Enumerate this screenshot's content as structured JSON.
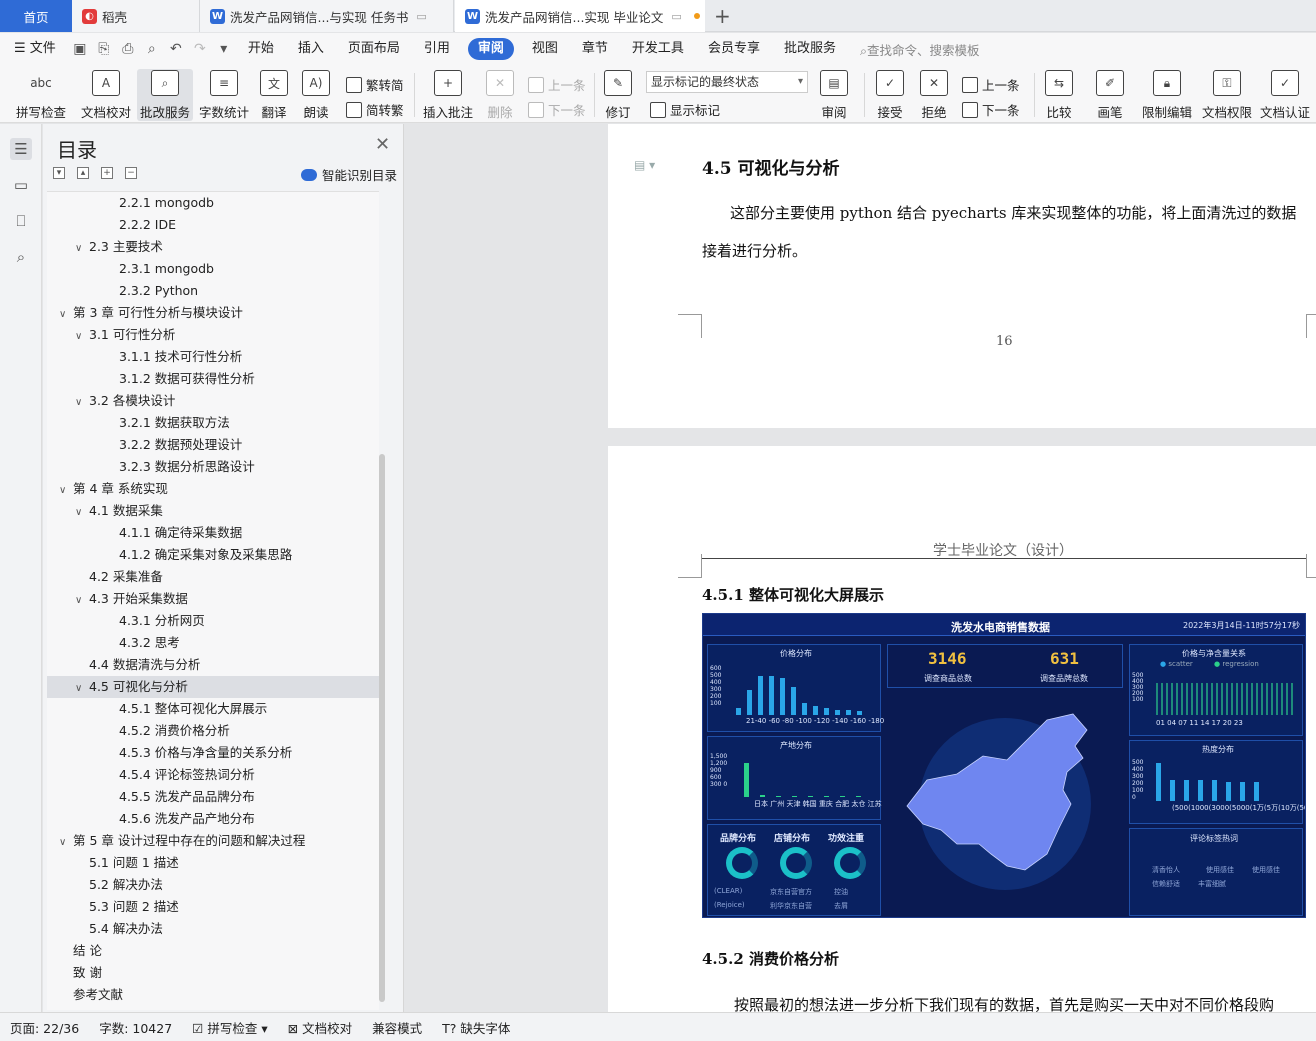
{
  "tabs": {
    "home": "首页",
    "t1": "稻壳",
    "t2": "洗发产品网销信...与实现 任务书",
    "t3": "洗发产品网销信...实现 毕业论文"
  },
  "menu": {
    "file": "文件",
    "items": [
      "开始",
      "插入",
      "页面布局",
      "引用",
      "审阅",
      "视图",
      "章节",
      "开发工具",
      "会员专享",
      "批改服务"
    ],
    "search": "查找命令、搜索模板"
  },
  "ribbon": {
    "spell": "拼写检查",
    "proof": "文档校对",
    "correct": "批改服务",
    "wordcount": "字数统计",
    "translate": "翻译",
    "read": "朗读",
    "to_trad": "繁转简",
    "to_simp": "简转繁",
    "insert_comment": "插入批注",
    "delete": "删除",
    "prev": "上一条",
    "next": "下一条",
    "revise": "修订",
    "markup_state": "显示标记的最终状态",
    "show_markup": "显示标记",
    "review": "审阅",
    "accept": "接受",
    "reject": "拒绝",
    "prev2": "上一条",
    "next2": "下一条",
    "compare": "比较",
    "pen": "画笔",
    "restrict": "限制编辑",
    "perm": "文档权限",
    "cert": "文档认证"
  },
  "toc": {
    "title": "目录",
    "smart": "智能识别目录",
    "items": [
      {
        "text": "2.2.1 mongodb",
        "level": 3
      },
      {
        "text": "2.2.2 IDE",
        "level": 3
      },
      {
        "text": "2.3 主要技术",
        "level": 2,
        "chev": true
      },
      {
        "text": "2.3.1 mongodb",
        "level": 3
      },
      {
        "text": "2.3.2 Python",
        "level": 3
      },
      {
        "text": "第 3 章  可行性分析与模块设计",
        "level": 1,
        "chev": true
      },
      {
        "text": "3.1  可行性分析",
        "level": 2,
        "chev": true
      },
      {
        "text": "3.1.1  技术可行性分析",
        "level": 3
      },
      {
        "text": "3.1.2  数据可获得性分析",
        "level": 3
      },
      {
        "text": "3.2  各模块设计",
        "level": 2,
        "chev": true
      },
      {
        "text": "3.2.1  数据获取方法",
        "level": 3
      },
      {
        "text": "3.2.2  数据预处理设计",
        "level": 3
      },
      {
        "text": "3.2.3  数据分析思路设计",
        "level": 3
      },
      {
        "text": "第 4 章  系统实现",
        "level": 1,
        "chev": true
      },
      {
        "text": "4.1 数据采集",
        "level": 2,
        "chev": true
      },
      {
        "text": "4.1.1 确定待采集数据",
        "level": 3
      },
      {
        "text": "4.1.2 确定采集对象及采集思路",
        "level": 3
      },
      {
        "text": "4.2 采集准备",
        "level": 2
      },
      {
        "text": "4.3 开始采集数据",
        "level": 2,
        "chev": true
      },
      {
        "text": "4.3.1 分析网页",
        "level": 3
      },
      {
        "text": "4.3.2 思考",
        "level": 3
      },
      {
        "text": "4.4 数据清洗与分析",
        "level": 2
      },
      {
        "text": "4.5  可视化与分析",
        "level": 2,
        "chev": true,
        "highlight": true
      },
      {
        "text": "4.5.1  整体可视化大屏展示",
        "level": 3
      },
      {
        "text": "4.5.2 消费价格分析",
        "level": 3
      },
      {
        "text": "4.5.3 价格与净含量的关系分析",
        "level": 3
      },
      {
        "text": "4.5.4  评论标签热词分析",
        "level": 3
      },
      {
        "text": "4.5.5  洗发产品品牌分布",
        "level": 3
      },
      {
        "text": "4.5.6  洗发产品产地分布",
        "level": 3
      },
      {
        "text": "第 5 章  设计过程中存在的问题和解决过程",
        "level": 1,
        "chev": true
      },
      {
        "text": "5.1 问题 1 描述",
        "level": 2
      },
      {
        "text": "5.2 解决办法",
        "level": 2
      },
      {
        "text": "5.3 问题 2 描述",
        "level": 2
      },
      {
        "text": "5.4 解决办法",
        "level": 2
      },
      {
        "text": "结    论",
        "level": 1
      },
      {
        "text": "致    谢",
        "level": 1
      },
      {
        "text": "参考文献",
        "level": 1
      }
    ]
  },
  "doc": {
    "h45": "4.5  可视化与分析",
    "p1a": "这部分主要使用 python 结合 pyecharts 库来实现整体的功能，将上面清洗过的数据",
    "p1b": "接着进行分析。",
    "pagenum": "16",
    "header": "学士毕业论文（设计）",
    "h451": "4.5.1  整体可视化大屏展示",
    "h452": "4.5.2 消费价格分析",
    "p2": "按照最初的想法进一步分析下我们现有的数据，首先是购买一天中对不同价格段购"
  },
  "dashboard": {
    "title": "洗发水电商销售数据",
    "time": "2022年3月14日-11时57分17秒",
    "price_dist": "价格分布",
    "origin_dist": "产地分布",
    "count1": "3146",
    "count1_label": "调查商品总数",
    "count2": "631",
    "count2_label": "调查品牌总数",
    "scatter_title": "价格与净含量关系",
    "legend_scatter": "scatter",
    "legend_reg": "regression",
    "hot_dist": "热度分布",
    "brand": "品牌分布",
    "shop": "店铺分布",
    "effect": "功效注重",
    "tags": "评论标签热词",
    "price_x": "21-40 -60 -80 -100 -120 -140 -160 -180",
    "origin_x": "日本 广州 天津 韩国 重庆 合肥 太仓 江苏",
    "hot_x": "(500(1000(3000(5000(1万(5万(10万(50万+)",
    "scatter_x": "01  04  07  11  14  17  20  23",
    "price_y": "600 500 400 300 200 100",
    "origin_y": "1,500 1,200 900 600 300 0",
    "hot_y": "500 400 300 200 100 0",
    "scatter_y": "500 400 300 200 100",
    "brand1": "(CLEAR)",
    "brand2": "(Rejoice)",
    "shop1": "京东自营官方",
    "shop2": "利华京东自营",
    "eff1": "控油",
    "eff2": "去屑",
    "tag1": "清香怡人",
    "tag2": "使用感佳",
    "tag3": "使用感佳",
    "tag4": "信赖舒适",
    "tag5": "丰富细腻",
    "price_bars": [
      0.15,
      0.55,
      0.85,
      0.85,
      0.8,
      0.6,
      0.25,
      0.2,
      0.15,
      0.1,
      0.1,
      0.08
    ],
    "origin_bars": [
      0.8,
      0.05,
      0.03,
      0.03,
      0.02,
      0.02,
      0.02,
      0.02
    ],
    "hot_bars": [
      0.9,
      0.5,
      0.5,
      0.5,
      0.5,
      0.45,
      0.45,
      0.45
    ]
  },
  "status": {
    "page": "页面: 22/36",
    "words": "字数: 10427",
    "spell": "拼写检查",
    "proof": "文档校对",
    "compat": "兼容模式",
    "font": "缺失字体"
  }
}
